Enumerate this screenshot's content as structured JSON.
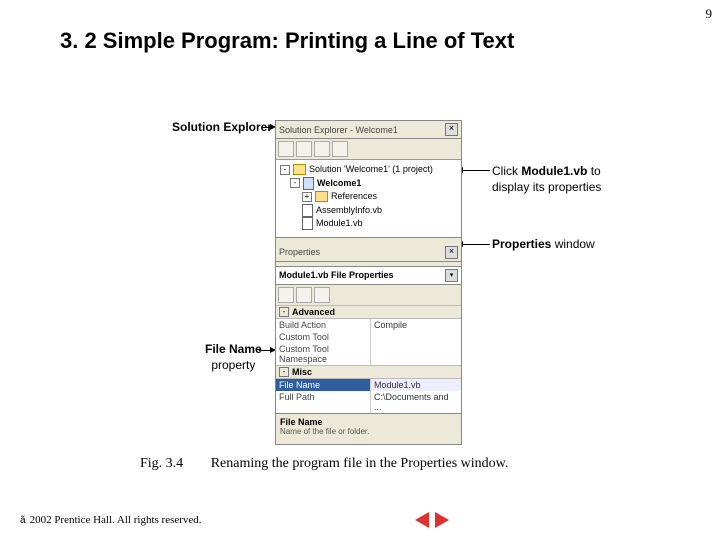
{
  "page_number": "9",
  "title": "3. 2 Simple Program: Printing a Line of Text",
  "callouts": {
    "solution_explorer": "Solution Explorer",
    "click_module_line1": "Click",
    "click_module_bold": "Module1.vb",
    "click_module_line1b": "to",
    "click_module_line2": "display its properties",
    "properties_window_bold": "Properties",
    "properties_window_rest": "window",
    "file_name_bold": "File Name",
    "file_name_rest": "property"
  },
  "solution_explorer": {
    "title": "Solution Explorer - Welcome1",
    "solution_line": "Solution 'Welcome1' (1 project)",
    "project": "Welcome1",
    "references": "References",
    "assembly": "AssemblyInfo.vb",
    "module": "Module1.vb"
  },
  "properties": {
    "title": "Properties",
    "combo": "Module1.vb  File Properties",
    "cat_advanced": "Advanced",
    "rows": {
      "build_action_k": "Build Action",
      "build_action_v": "Compile",
      "custom_tool_k": "Custom Tool",
      "custom_tool_v": "",
      "custom_tool_ns_k": "Custom Tool Namespace",
      "custom_tool_ns_v": ""
    },
    "cat_misc": "Misc",
    "file_name_k": "File Name",
    "file_name_v": "Module1.vb",
    "full_path_k": "Full Path",
    "full_path_v": "C:\\Documents and ...",
    "help_title": "File Name",
    "help_text": "Name of the file or folder."
  },
  "caption": {
    "num": "Fig. 3.4",
    "text": "Renaming the program file in the Properties window."
  },
  "footer": "2002 Prentice Hall. All rights reserved."
}
